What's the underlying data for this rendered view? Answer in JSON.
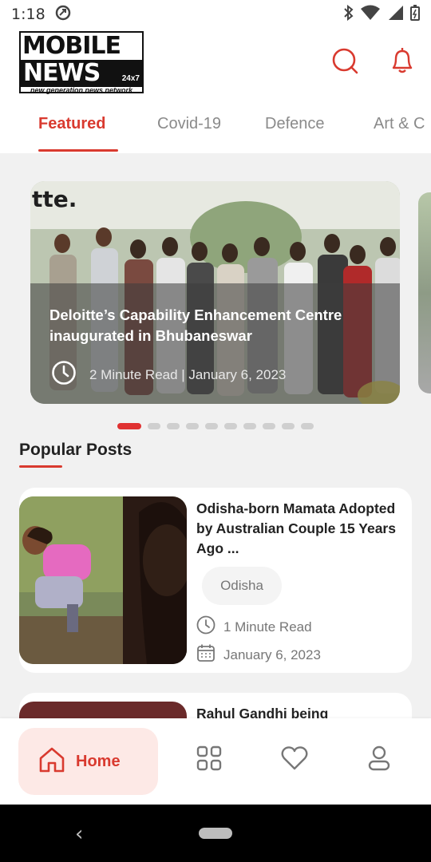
{
  "status_bar": {
    "time": "1:18"
  },
  "header": {
    "logo": {
      "line1": "MOBILE",
      "line2": "NEWS",
      "tag": "24x7",
      "tagline": "new generation news network"
    },
    "search_icon": "search-icon",
    "notification_icon": "bell-icon"
  },
  "tabs": [
    {
      "label": "Featured",
      "active": true
    },
    {
      "label": "Covid-19",
      "active": false
    },
    {
      "label": "Defence",
      "active": false
    },
    {
      "label": "Art & C",
      "active": false
    }
  ],
  "featured": {
    "title": "Deloitte’s Capability Enhancement Centre inaugurated in Bhubaneswar",
    "meta": "2  Minute Read | January 6, 2023",
    "photo_sign": "tte.",
    "dots_count": 10,
    "active_dot": 0
  },
  "popular": {
    "section_title": "Popular Posts",
    "posts": [
      {
        "title": "Odisha-born Mamata Adopted by Australian Couple 15 Years Ago ...",
        "category": "Odisha",
        "read_time": "1 Minute Read",
        "date": "January 6, 2023"
      },
      {
        "title": "Rahul Gandhi being"
      }
    ]
  },
  "bottom_nav": {
    "home_label": "Home",
    "items": [
      "home-icon",
      "grid-icon",
      "heart-icon",
      "profile-icon"
    ]
  },
  "colors": {
    "accent": "#d93a2f",
    "home_bg": "#fde9e6",
    "background": "#f1f1f1"
  }
}
